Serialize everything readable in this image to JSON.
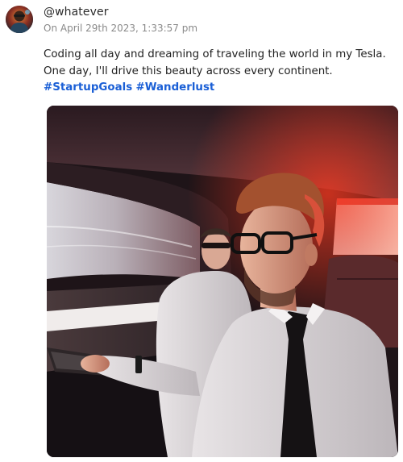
{
  "post": {
    "username": "@whatever",
    "timestamp": "On April 29th 2023, 1:33:57 pm",
    "text_line_1": "Coding all day and dreaming of traveling the world in my Tesla.",
    "text_line_2": "One day, I'll drive this beauty across every continent.",
    "hashtags": [
      "#StartupGoals",
      "#Wanderlust"
    ]
  },
  "icons": {
    "avatar": "user-avatar-icon"
  }
}
